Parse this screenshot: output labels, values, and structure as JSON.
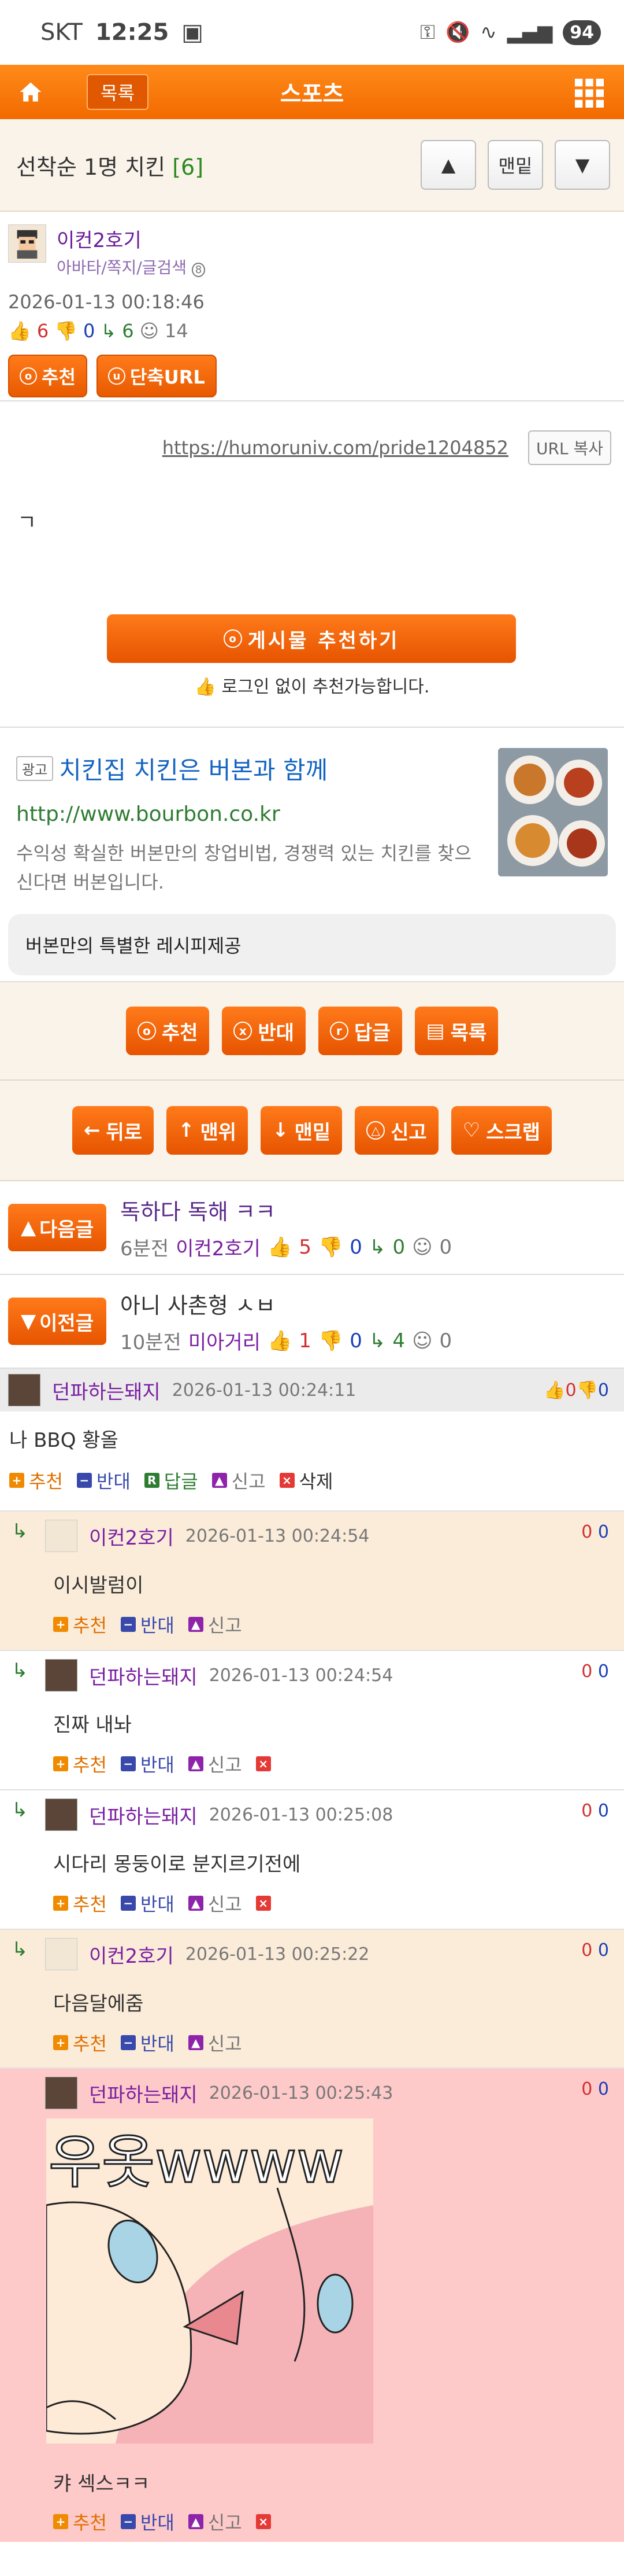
{
  "status": {
    "carrier": "SKT",
    "time": "12:25",
    "battery": "94"
  },
  "nav": {
    "list_label": "목록",
    "title": "스포츠"
  },
  "post": {
    "title": "선착순 1명 치킨",
    "comment_count": "[6]",
    "bottom_label": "맨밑"
  },
  "author": {
    "name": "이컨2호기",
    "links": "아바타/쪽지/글검색",
    "date": "2026-01-13 00:18:46",
    "up": "6",
    "down": "0",
    "reply": "6",
    "views": "14",
    "rec_label": "추천",
    "url_label": "단축URL"
  },
  "body": {
    "url": "https://humoruniv.com/pride1204852",
    "copy_label": "URL 복사",
    "content": "ㄱ",
    "recommend_label": "게시물 추천하기",
    "recommend_note": "로그인 없이 추천가능합니다."
  },
  "ad": {
    "tag": "광고",
    "title": "치킨집 치킨은 버본과 함께",
    "site": "http://www.bourbon.co.kr",
    "desc": "수익성 확실한 버본만의 창업비법, 경쟁력 있는 치킨를 찾으신다면 버본입니다.",
    "bottom": "버본만의 특별한 레시피제공"
  },
  "bar1": {
    "rec": "추천",
    "opp": "반대",
    "reply": "답글",
    "list": "목록"
  },
  "bar2": {
    "back": "뒤로",
    "top": "맨위",
    "bottom": "맨밑",
    "report": "신고",
    "scrap": "스크랩"
  },
  "next": {
    "label": "다음글",
    "title": "독하다 독해 ㅋㅋ",
    "ago": "6분전",
    "author": "이컨2호기",
    "up": "5",
    "down": "0",
    "reply": "0",
    "views": "0"
  },
  "prev": {
    "label": "이전글",
    "title": "아니 사촌형 ㅅㅂ",
    "ago": "10분전",
    "author": "미아거리",
    "up": "1",
    "down": "0",
    "reply": "4",
    "views": "0"
  },
  "comment_actions": {
    "rec": "추천",
    "opp": "반대",
    "reply": "답글",
    "report": "신고",
    "delete": "삭제"
  },
  "comments": [
    {
      "name": "던파하는돼지",
      "time": "2026-01-13 00:24:11",
      "text": "나 BBQ 황올",
      "up": "0",
      "down": "0"
    },
    {
      "name": "이컨2호기",
      "time": "2026-01-13 00:24:54",
      "text": "이시발럼이",
      "up": "0",
      "down": "0"
    },
    {
      "name": "던파하는돼지",
      "time": "2026-01-13 00:24:54",
      "text": "진짜 내놔",
      "up": "0",
      "down": "0"
    },
    {
      "name": "던파하는돼지",
      "time": "2026-01-13 00:25:08",
      "text": "시다리 몽둥이로 분지르기전에",
      "up": "0",
      "down": "0"
    },
    {
      "name": "이컨2호기",
      "time": "2026-01-13 00:25:22",
      "text": "다음달에줌",
      "up": "0",
      "down": "0"
    },
    {
      "name": "던파하는돼지",
      "time": "2026-01-13 00:25:43",
      "text": "캬 섹스ㅋㅋ",
      "up": "0",
      "down": "0",
      "image_text": "우옷wwww"
    }
  ]
}
